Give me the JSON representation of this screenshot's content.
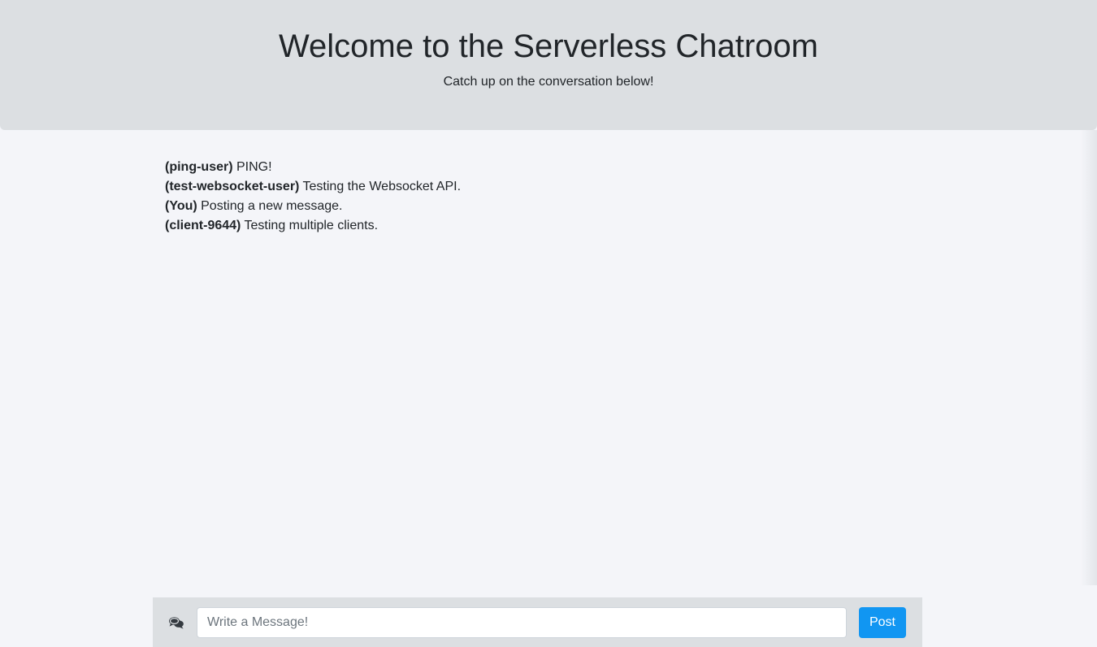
{
  "header": {
    "title": "Welcome to the Serverless Chatroom",
    "subtitle": "Catch up on the conversation below!"
  },
  "messages": [
    {
      "author": "(ping-user)",
      "text": " PING!"
    },
    {
      "author": "(test-websocket-user)",
      "text": " Testing the Websocket API."
    },
    {
      "author": "(You)",
      "text": " Posting a new message."
    },
    {
      "author": "(client-9644)",
      "text": " Testing multiple clients."
    }
  ],
  "compose": {
    "icon": "comments-icon",
    "placeholder": "Write a Message!",
    "value": "",
    "post_label": "Post"
  },
  "colors": {
    "header_bg": "#dcdfe2",
    "page_bg": "#f4f5f9",
    "accent": "#1196f2"
  }
}
